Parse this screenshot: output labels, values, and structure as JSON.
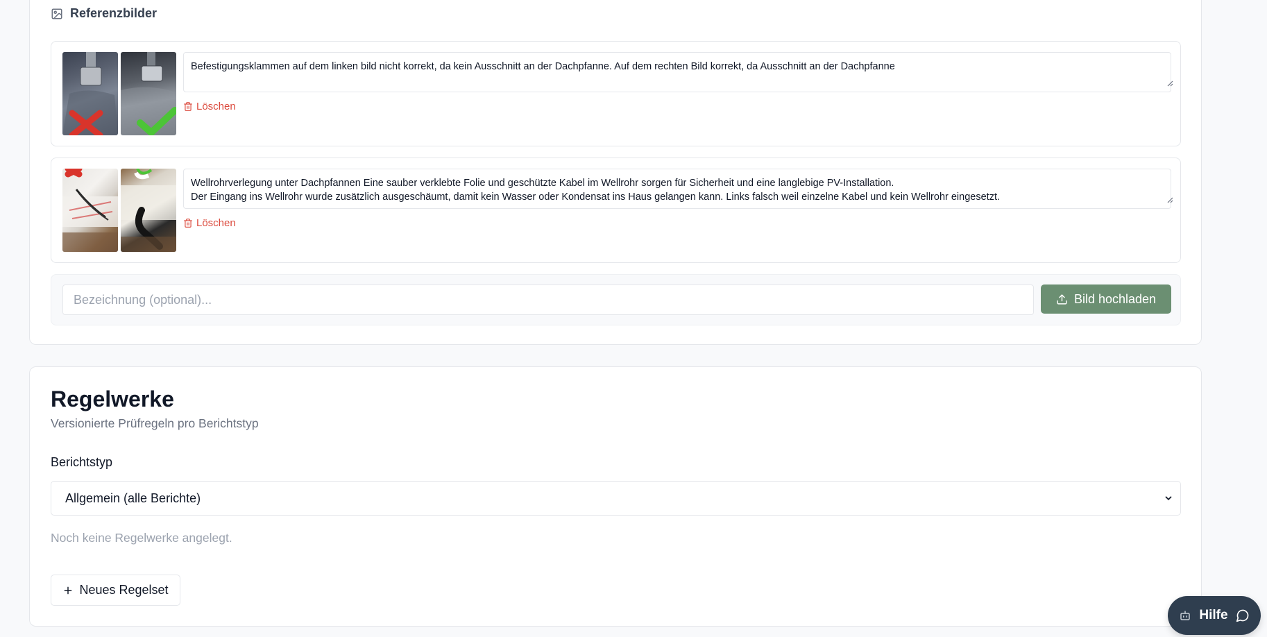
{
  "reference_section": {
    "title": "Referenzbilder",
    "items": [
      {
        "description": "Befestigungsklammen auf dem linken bild nicht korrekt, da kein Ausschnitt an der Dachpfanne. Auf dem rechten Bild korrekt, da Ausschnitt an der Dachpfanne",
        "delete_label": "Löschen",
        "image_marks": [
          "cross",
          "check"
        ]
      },
      {
        "description": "Wellrohrverlegung unter Dachpfannen Eine sauber verklebte Folie und geschützte Kabel im Wellrohr sorgen für Sicherheit und eine langlebige PV-Installation.\nDer Eingang ins Wellrohr wurde zusätzlich ausgeschäumt, damit kein Wasser oder Kondensat ins Haus gelangen kann. Links falsch weil einzelne Kabel und kein Wellrohr eingesetzt.",
        "delete_label": "Löschen",
        "image_marks": [
          "cross",
          "check"
        ]
      }
    ],
    "upload": {
      "placeholder": "Bezeichnung (optional)...",
      "value": "",
      "button_label": "Bild hochladen"
    }
  },
  "rules_section": {
    "title": "Regelwerke",
    "subtitle": "Versionierte Prüfregeln pro Berichtstyp",
    "field_label": "Berichtstyp",
    "selected_value": "Allgemein (alle Berichte)",
    "empty_text": "Noch keine Regelwerke angelegt.",
    "new_button_label": "Neues Regelset"
  },
  "help": {
    "label": "Hilfe"
  },
  "icons": {
    "section": "image-icon",
    "delete": "trash-icon",
    "upload": "upload-icon",
    "select": "chevron-down-icon",
    "add": "plus-icon",
    "help_left": "bot-icon",
    "help_right": "chat-bubble-icon"
  },
  "colors": {
    "accent_green": "#6b8f72",
    "danger": "#dc4b3e",
    "help_bg": "#2f3e4f",
    "mark_cross": "#d9342b",
    "mark_check": "#4cc437"
  }
}
